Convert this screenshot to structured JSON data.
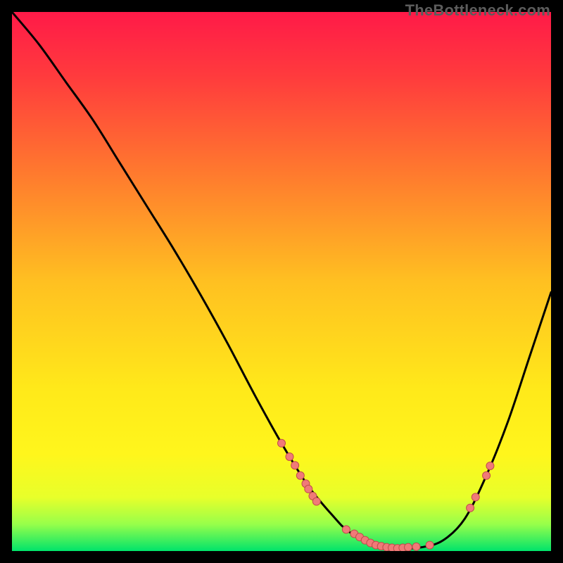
{
  "watermark": "TheBottleneck.com",
  "chart_data": {
    "type": "line",
    "title": "",
    "xlabel": "",
    "ylabel": "",
    "xlim": [
      0,
      100
    ],
    "ylim": [
      0,
      100
    ],
    "gradient_stops": [
      {
        "offset": 0.0,
        "color": "#ff1a48"
      },
      {
        "offset": 0.12,
        "color": "#ff3b3d"
      },
      {
        "offset": 0.3,
        "color": "#ff7a2e"
      },
      {
        "offset": 0.5,
        "color": "#ffc021"
      },
      {
        "offset": 0.7,
        "color": "#ffe91a"
      },
      {
        "offset": 0.82,
        "color": "#fff61c"
      },
      {
        "offset": 0.9,
        "color": "#e8ff2a"
      },
      {
        "offset": 0.95,
        "color": "#98ff4a"
      },
      {
        "offset": 1.0,
        "color": "#00e36b"
      }
    ],
    "curve": {
      "x": [
        0,
        5,
        10,
        15,
        20,
        25,
        30,
        35,
        40,
        45,
        50,
        55,
        60,
        62,
        65,
        68,
        72,
        76,
        80,
        84,
        88,
        92,
        96,
        100
      ],
      "y": [
        100,
        94,
        87,
        80,
        72,
        64,
        56,
        47.5,
        38.5,
        29,
        20,
        12,
        6,
        4,
        2,
        1,
        0.5,
        0.7,
        2,
        6,
        14,
        24,
        36,
        48
      ]
    },
    "markers": [
      {
        "x": 50.0,
        "y": 20.0
      },
      {
        "x": 51.5,
        "y": 17.5
      },
      {
        "x": 52.5,
        "y": 15.9
      },
      {
        "x": 53.5,
        "y": 14.0
      },
      {
        "x": 54.5,
        "y": 12.5
      },
      {
        "x": 55.0,
        "y": 11.5
      },
      {
        "x": 55.8,
        "y": 10.2
      },
      {
        "x": 56.5,
        "y": 9.2
      },
      {
        "x": 62.0,
        "y": 4.0
      },
      {
        "x": 63.5,
        "y": 3.2
      },
      {
        "x": 64.5,
        "y": 2.6
      },
      {
        "x": 65.5,
        "y": 2.0
      },
      {
        "x": 66.5,
        "y": 1.5
      },
      {
        "x": 67.5,
        "y": 1.1
      },
      {
        "x": 68.5,
        "y": 0.9
      },
      {
        "x": 69.5,
        "y": 0.7
      },
      {
        "x": 70.5,
        "y": 0.6
      },
      {
        "x": 71.5,
        "y": 0.5
      },
      {
        "x": 72.5,
        "y": 0.6
      },
      {
        "x": 73.5,
        "y": 0.7
      },
      {
        "x": 75.0,
        "y": 0.8
      },
      {
        "x": 77.5,
        "y": 1.1
      },
      {
        "x": 85.0,
        "y": 8.0
      },
      {
        "x": 86.0,
        "y": 10.0
      },
      {
        "x": 88.0,
        "y": 14.0
      },
      {
        "x": 88.7,
        "y": 15.8
      }
    ],
    "marker_style": {
      "fill": "#f07a78",
      "stroke": "#c04d4b",
      "r": 5.5
    },
    "curve_style": {
      "stroke": "#000000",
      "width": 3
    }
  }
}
